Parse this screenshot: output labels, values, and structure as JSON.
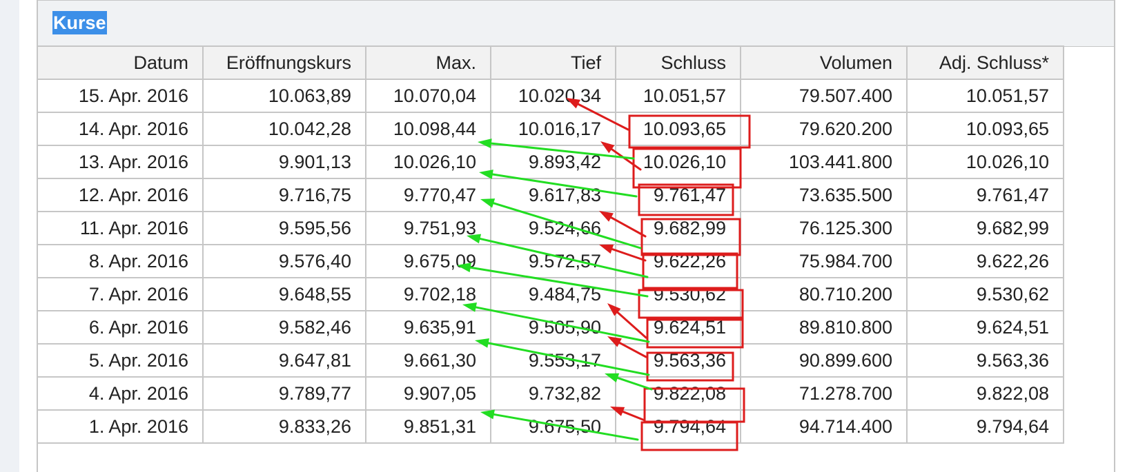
{
  "section": {
    "title": "Kurse"
  },
  "table": {
    "headers": [
      "Datum",
      "Eröffnungskurs",
      "Max.",
      "Tief",
      "Schluss",
      "Volumen",
      "Adj. Schluss*"
    ],
    "rows": [
      [
        "15. Apr. 2016",
        "10.063,89",
        "10.070,04",
        "10.020,34",
        "10.051,57",
        "79.507.400",
        "10.051,57"
      ],
      [
        "14. Apr. 2016",
        "10.042,28",
        "10.098,44",
        "10.016,17",
        "10.093,65",
        "79.620.200",
        "10.093,65"
      ],
      [
        "13. Apr. 2016",
        "9.901,13",
        "10.026,10",
        "9.893,42",
        "10.026,10",
        "103.441.800",
        "10.026,10"
      ],
      [
        "12. Apr. 2016",
        "9.716,75",
        "9.770,47",
        "9.617,83",
        "9.761,47",
        "73.635.500",
        "9.761,47"
      ],
      [
        "11. Apr. 2016",
        "9.595,56",
        "9.751,93",
        "9.524,66",
        "9.682,99",
        "76.125.300",
        "9.682,99"
      ],
      [
        "8. Apr. 2016",
        "9.576,40",
        "9.675,09",
        "9.572,57",
        "9.622,26",
        "75.984.700",
        "9.622,26"
      ],
      [
        "7. Apr. 2016",
        "9.648,55",
        "9.702,18",
        "9.484,75",
        "9.530,62",
        "80.710.200",
        "9.530,62"
      ],
      [
        "6. Apr. 2016",
        "9.582,46",
        "9.635,91",
        "9.505,90",
        "9.624,51",
        "89.810.800",
        "9.624,51"
      ],
      [
        "5. Apr. 2016",
        "9.647,81",
        "9.661,30",
        "9.553,17",
        "9.563,36",
        "90.899.600",
        "9.563,36"
      ],
      [
        "4. Apr. 2016",
        "9.789,77",
        "9.907,05",
        "9.732,82",
        "9.822,08",
        "71.278.700",
        "9.822,08"
      ],
      [
        "1. Apr. 2016",
        "9.833,26",
        "9.851,31",
        "9.675,50",
        "9.794,64",
        "94.714.400",
        "9.794,64"
      ]
    ]
  },
  "annotations": {
    "box_color": "#dd1c1c",
    "red_arrow_color": "#dd1c1c",
    "green_arrow_color": "#22dd22"
  }
}
